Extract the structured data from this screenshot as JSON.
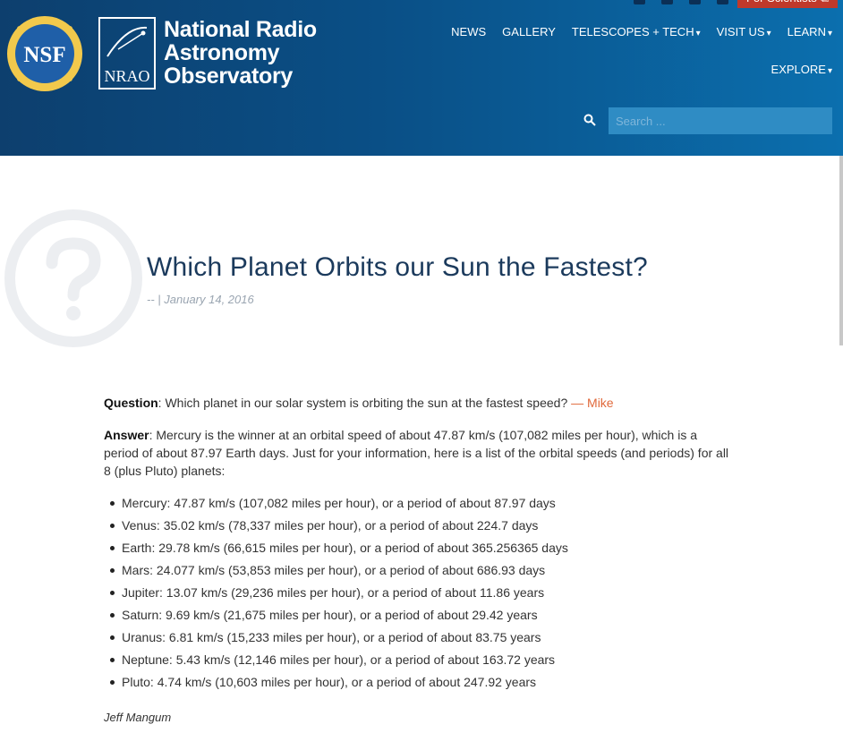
{
  "header": {
    "org_name_line1": "National Radio",
    "org_name_line2": "Astronomy",
    "org_name_line3": "Observatory",
    "nsf_logo_text": "NSF",
    "nrao_logo_text": "NRAO",
    "for_scientists_label": "For Scientists",
    "search_placeholder": "Search ...",
    "colors": {
      "header_dark": "#0d3f6e",
      "header_light": "#0b6fae",
      "accent": "#c0392b"
    }
  },
  "nav": {
    "items": [
      {
        "label": "NEWS",
        "caret": ""
      },
      {
        "label": "GALLERY",
        "caret": ""
      },
      {
        "label": "TELESCOPES + TECH",
        "caret": "▾"
      },
      {
        "label": "VISIT US",
        "caret": "▾"
      },
      {
        "label": "LEARN",
        "caret": "▾"
      }
    ],
    "second_row": {
      "label": "EXPLORE",
      "caret": "▾"
    }
  },
  "article": {
    "title": "Which Planet Orbits our Sun the Fastest?",
    "meta": "-- | January 14, 2016",
    "question_label": "Question",
    "question_text": ": Which planet in our solar system is orbiting the sun at the fastest speed?  ",
    "asker": "— Mike",
    "answer_label": "Answer",
    "answer_text": ": Mercury is the winner at an orbital speed of about 47.87 km/s (107,082 miles per hour), which is a period of about 87.97 Earth days.  Just for your information, here is a list of the orbital speeds (and periods) for all 8 (plus Pluto) planets:",
    "planets": [
      "Mercury: 47.87 km/s (107,082 miles per hour), or a period of about 87.97 days",
      "Venus: 35.02 km/s (78,337 miles per hour), or a period of about 224.7 days",
      "Earth: 29.78 km/s (66,615 miles per hour), or a period of about 365.256365 days",
      "Mars: 24.077 km/s (53,853 miles per hour), or a period of about 686.93 days",
      "Jupiter: 13.07 km/s (29,236 miles per hour), or a period of about 11.86 years",
      "Saturn: 9.69 km/s (21,675 miles per hour), or a period of about 29.42 years",
      "Uranus: 6.81 km/s (15,233 miles per hour), or a period of about 83.75 years",
      "Neptune: 5.43 km/s (12,146 miles per hour), or a period of about 163.72 years",
      "Pluto: 4.74 km/s (10,603 miles per hour), or a period of about 247.92 years"
    ],
    "author": "Jeff Mangum"
  }
}
